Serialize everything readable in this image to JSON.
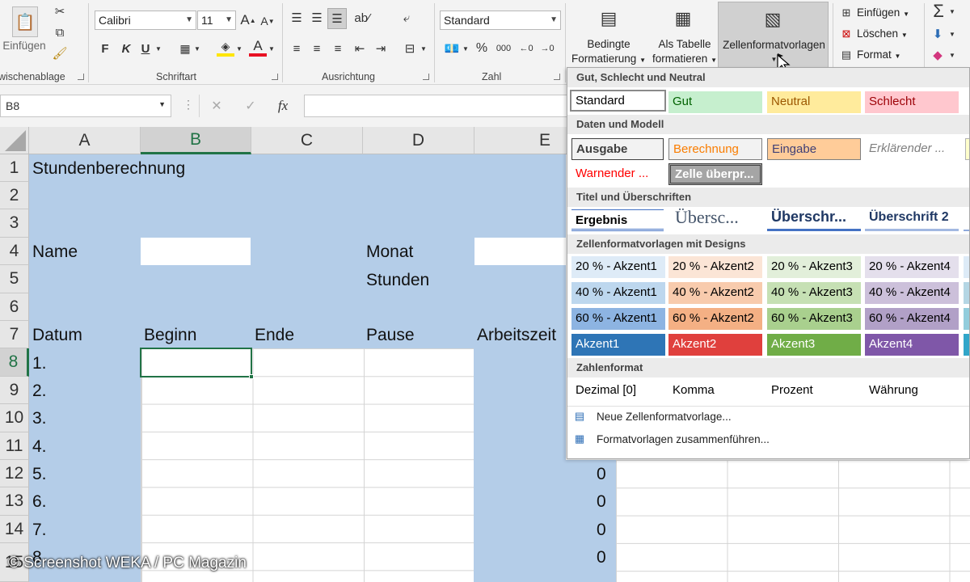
{
  "ribbon": {
    "clipboard": {
      "paste_label": "Einfügen",
      "group_label": "wischenablage"
    },
    "font": {
      "name": "Calibri",
      "size": "11",
      "bold": "F",
      "italic": "K",
      "underline": "U",
      "grow": "A",
      "shrink": "A",
      "group_label": "Schriftart"
    },
    "alignment": {
      "group_label": "Ausrichtung"
    },
    "number": {
      "format": "Standard",
      "percent": "%",
      "thousands": "000",
      "group_label": "Zahl"
    },
    "styles": {
      "conditional_line1": "Bedingte",
      "conditional_line2": "Formatierung",
      "table_line1": "Als Tabelle",
      "table_line2": "formatieren",
      "cellstyles": "Zellenformatvorlagen"
    },
    "cells": {
      "insert": "Einfügen",
      "delete": "Löschen",
      "format": "Format"
    },
    "editing": {
      "sum": "Σ"
    }
  },
  "formula_bar": {
    "name_box": "B8",
    "fx": "fx",
    "cancel": "✕",
    "enter": "✓",
    "value": ""
  },
  "sheet": {
    "columns": [
      "A",
      "B",
      "C",
      "D",
      "E"
    ],
    "rows": [
      "1",
      "2",
      "3",
      "4",
      "5",
      "6",
      "7",
      "8",
      "9",
      "10",
      "11",
      "12",
      "13",
      "14",
      "15"
    ],
    "title": "Stundenberechnung",
    "name_label": "Name",
    "monat_label": "Monat",
    "stunden_label": "Stunden",
    "headers": {
      "datum": "Datum",
      "beginn": "Beginn",
      "ende": "Ende",
      "pause": "Pause",
      "arbeitszeit": "Arbeitszeit"
    },
    "days": [
      "1.",
      "2.",
      "3.",
      "4.",
      "5.",
      "6.",
      "7.",
      "8."
    ],
    "zero_values": [
      "0",
      "0",
      "0",
      "0"
    ],
    "selected_cell": "B8"
  },
  "menu": {
    "sections": {
      "gut": "Gut, Schlecht und Neutral",
      "daten": "Daten und Modell",
      "titel": "Titel und Überschriften",
      "designs": "Zellenformatvorlagen mit Designs",
      "zahl": "Zahlenformat"
    },
    "gut_styles": [
      "Standard",
      "Gut",
      "Neutral",
      "Schlecht"
    ],
    "daten_row1": [
      "Ausgabe",
      "Berechnung",
      "Eingabe",
      "Erklärender ..."
    ],
    "daten_row2": [
      "Warnender ...",
      "Zelle überpr..."
    ],
    "titel_styles": [
      "Ergebnis",
      "Übersc...",
      "Überschr...",
      "Überschrift 2"
    ],
    "accent_20": [
      "20 % - Akzent1",
      "20 % - Akzent2",
      "20 % - Akzent3",
      "20 % - Akzent4"
    ],
    "accent_40": [
      "40 % - Akzent1",
      "40 % - Akzent2",
      "40 % - Akzent3",
      "40 % - Akzent4"
    ],
    "accent_60": [
      "60 % - Akzent1",
      "60 % - Akzent2",
      "60 % - Akzent3",
      "60 % - Akzent4"
    ],
    "accent_full": [
      "Akzent1",
      "Akzent2",
      "Akzent3",
      "Akzent4"
    ],
    "zahl_styles": [
      "Dezimal [0]",
      "Komma",
      "Prozent",
      "Währung"
    ],
    "new_style": "Neue Zellenformatvorlage...",
    "merge_styles": "Formatvorlagen zusammenführen..."
  },
  "watermark": "© Screenshot WEKA / PC Magazin",
  "colors": {
    "sheet_blue": "#b4cde8",
    "selection": "#217346",
    "menu_hover": "#d0d0d0"
  }
}
